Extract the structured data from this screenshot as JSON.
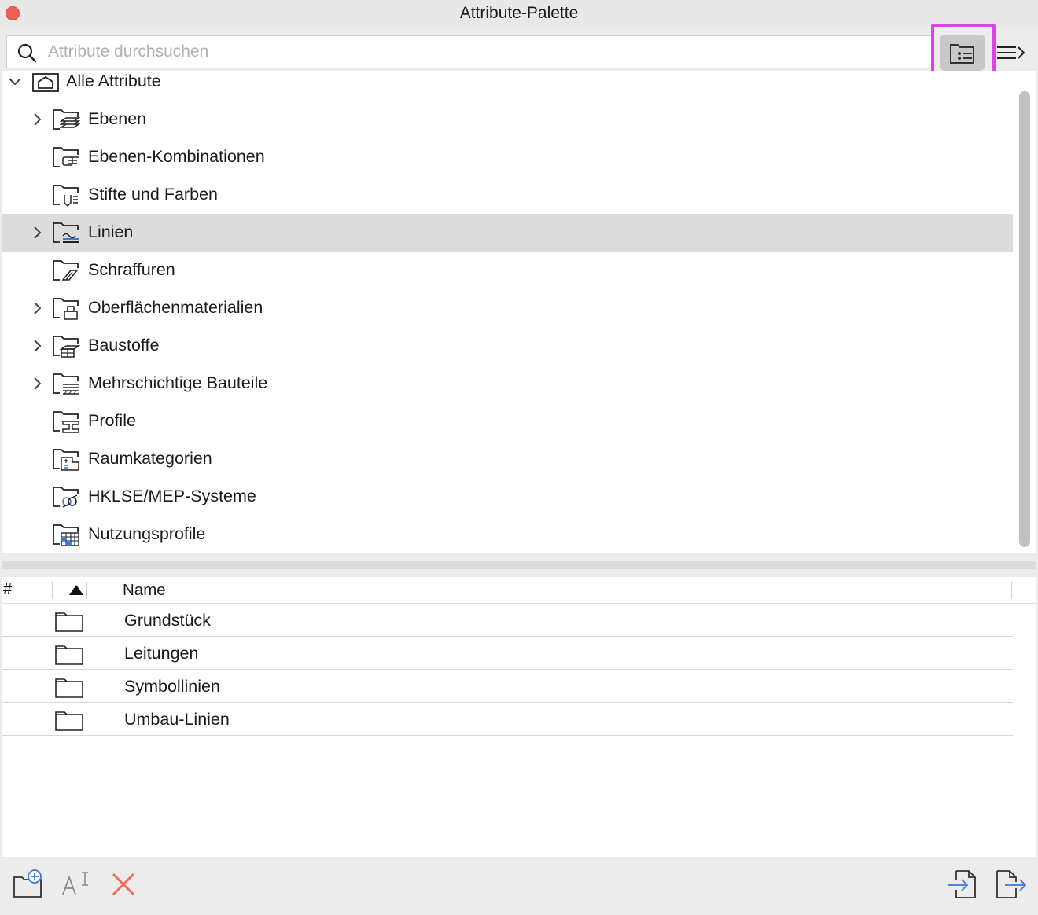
{
  "window": {
    "title": "Attribute-Palette"
  },
  "search": {
    "placeholder": "Attribute durchsuchen",
    "value": ""
  },
  "toolbar": {
    "folder_view_icon": "folder-list-icon",
    "menu_icon": "list-menu-icon"
  },
  "tree": {
    "root": {
      "label": "Alle Attribute",
      "expanded": true,
      "icon": "house-folder-icon"
    },
    "items": [
      {
        "label": "Ebenen",
        "expandable": true,
        "icon": "layers-folder-icon"
      },
      {
        "label": "Ebenen-Kombinationen",
        "expandable": false,
        "icon": "layer-combinations-folder-icon"
      },
      {
        "label": "Stifte und Farben",
        "expandable": false,
        "icon": "pens-colors-folder-icon"
      },
      {
        "label": "Linien",
        "expandable": true,
        "icon": "lines-folder-icon",
        "selected": true
      },
      {
        "label": "Schraffuren",
        "expandable": false,
        "icon": "fills-folder-icon"
      },
      {
        "label": "Oberflächenmaterialien",
        "expandable": true,
        "icon": "surfaces-folder-icon"
      },
      {
        "label": "Baustoffe",
        "expandable": true,
        "icon": "building-materials-folder-icon"
      },
      {
        "label": "Mehrschichtige Bauteile",
        "expandable": true,
        "icon": "composites-folder-icon"
      },
      {
        "label": "Profile",
        "expandable": false,
        "icon": "profiles-folder-icon"
      },
      {
        "label": "Raumkategorien",
        "expandable": false,
        "icon": "zone-categories-folder-icon"
      },
      {
        "label": "HKLSE/MEP-Systeme",
        "expandable": false,
        "icon": "mep-systems-folder-icon"
      },
      {
        "label": "Nutzungsprofile",
        "expandable": false,
        "icon": "operation-profiles-folder-icon"
      }
    ]
  },
  "list": {
    "columns": {
      "hash": "#",
      "name": "Name",
      "sort": "ascending"
    },
    "rows": [
      {
        "name": "Grundstück"
      },
      {
        "name": "Leitungen"
      },
      {
        "name": "Symbollinien"
      },
      {
        "name": "Umbau-Linien"
      }
    ]
  },
  "bottom_toolbar": {
    "left": [
      "new-folder-icon",
      "rename-icon",
      "delete-icon"
    ],
    "right": [
      "import-icon",
      "export-icon"
    ]
  },
  "colors": {
    "highlight": "#e040e8",
    "delete": "#e8705f",
    "accent_blue": "#3b78d8",
    "close": "#ee5f57"
  }
}
